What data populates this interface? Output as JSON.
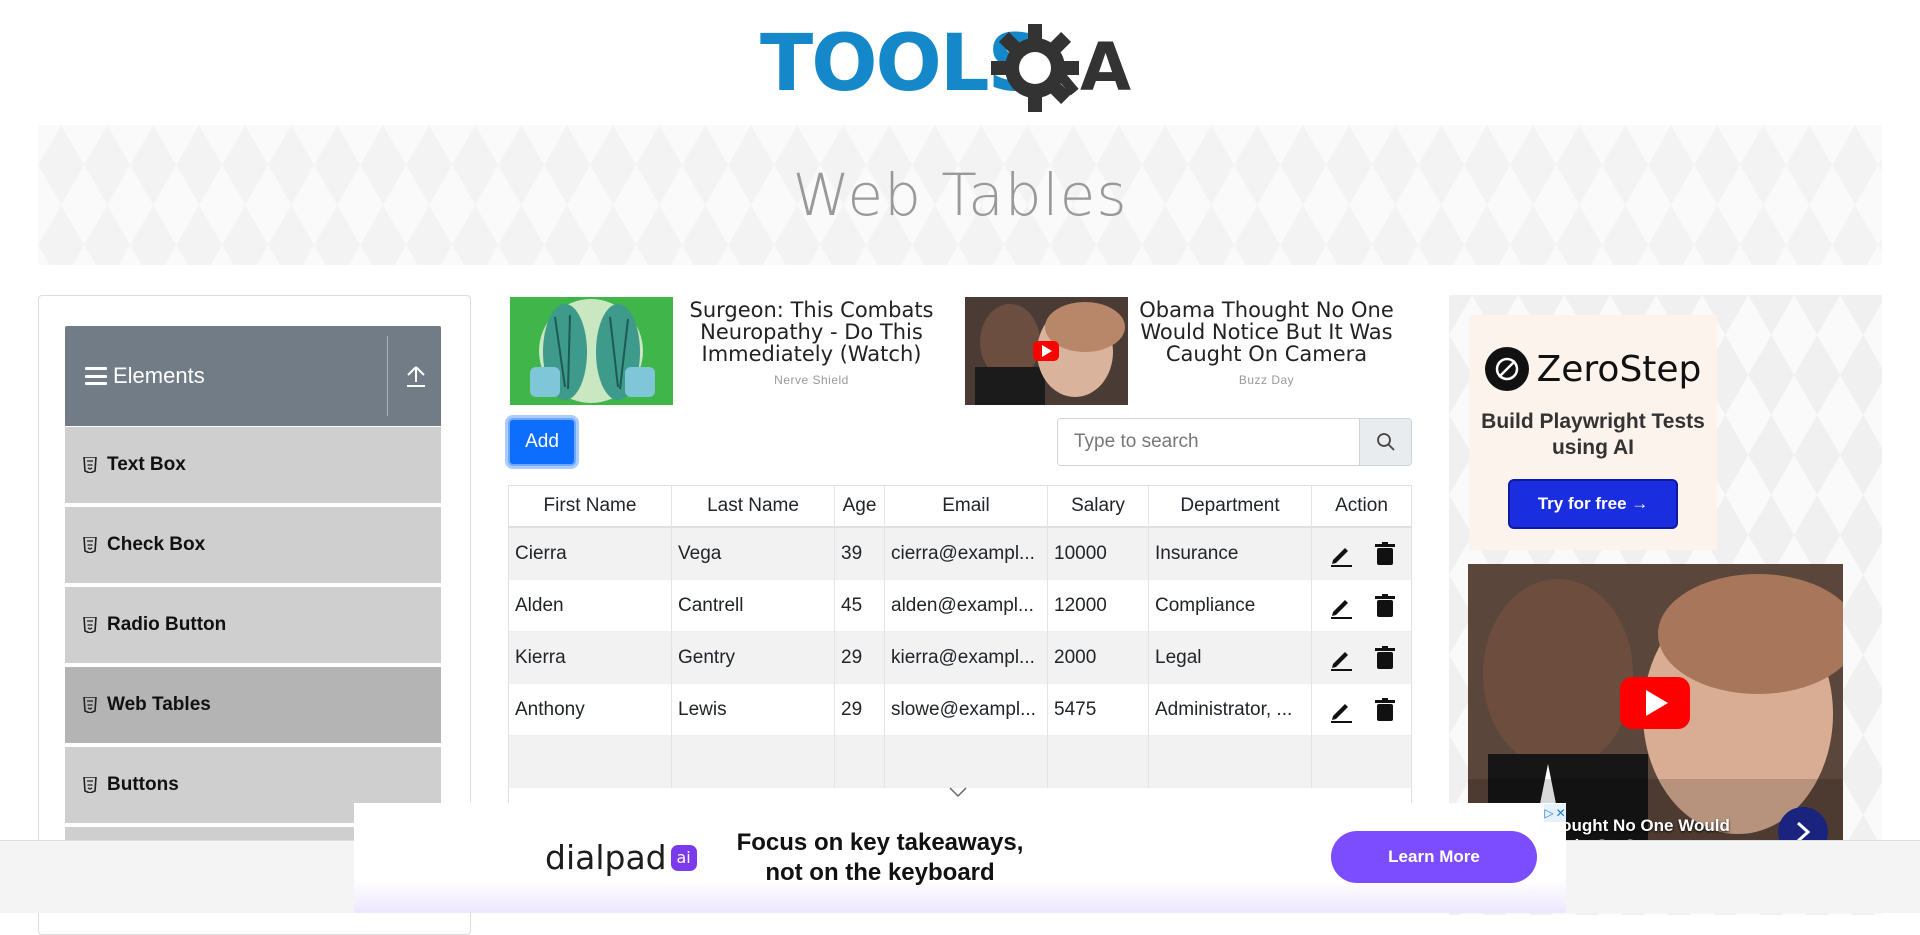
{
  "brand": {
    "logo_text": "TOOLSQA"
  },
  "page_title": "Web Tables",
  "sidebar": {
    "group_title": "Elements",
    "items": [
      {
        "label": "Text Box"
      },
      {
        "label": "Check Box"
      },
      {
        "label": "Radio Button"
      },
      {
        "label": "Web Tables",
        "active": true
      },
      {
        "label": "Buttons"
      }
    ]
  },
  "ads_row": [
    {
      "headline": "Surgeon: This Combats Neuropathy - Do This Immediately (Watch)",
      "source": "Nerve Shield"
    },
    {
      "headline": "Obama Thought No One Would Notice But It Was Caught On Camera",
      "source": "Buzz Day"
    }
  ],
  "toolbar": {
    "add_label": "Add"
  },
  "search": {
    "placeholder": "Type to search",
    "value": ""
  },
  "table": {
    "headers": [
      "First Name",
      "Last Name",
      "Age",
      "Email",
      "Salary",
      "Department",
      "Action"
    ],
    "rows": [
      [
        "Cierra",
        "Vega",
        "39",
        "cierra@exampl...",
        "10000",
        "Insurance"
      ],
      [
        "Alden",
        "Cantrell",
        "45",
        "alden@exampl...",
        "12000",
        "Compliance"
      ],
      [
        "Kierra",
        "Gentry",
        "29",
        "kierra@exampl...",
        "2000",
        "Legal"
      ],
      [
        "Anthony",
        "Lewis",
        "29",
        "slowe@exampl...",
        "5475",
        "Administrator, ..."
      ]
    ]
  },
  "right_ad": {
    "brand": "ZeroStep",
    "tagline": "Build Playwright Tests using AI",
    "cta": "Try for free →",
    "video_caption": "Obama Thought No One Would\nIt Was Caught On Camera"
  },
  "bottom_ad": {
    "brand": "dialpad",
    "brand_badge": "ai",
    "headline": "Focus on key takeaways, not on the keyboard",
    "cta": "Learn More"
  },
  "colors": {
    "primary": "#0d6efd",
    "sidebar_header": "#727c86",
    "menu_item": "#cfcfcf",
    "logo_blue": "#1588c9",
    "logo_dark": "#333333"
  }
}
